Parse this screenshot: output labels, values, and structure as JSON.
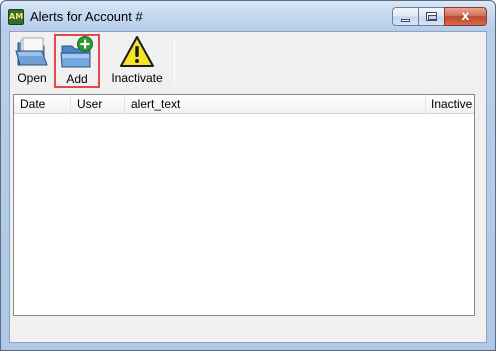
{
  "window": {
    "title": "Alerts for Account #",
    "app_icon": "AM",
    "close_glyph": "x"
  },
  "toolbar": {
    "open_label": "Open",
    "add_label": "Add",
    "inactivate_label": "Inactivate"
  },
  "alerts_list": {
    "columns": [
      "Date",
      "User",
      "alert_text",
      "Inactive"
    ],
    "rows": []
  },
  "colors": {
    "highlight": "#e04a4a",
    "add_badge": "#2e9a2e",
    "warning_yellow": "#f5e32a"
  }
}
